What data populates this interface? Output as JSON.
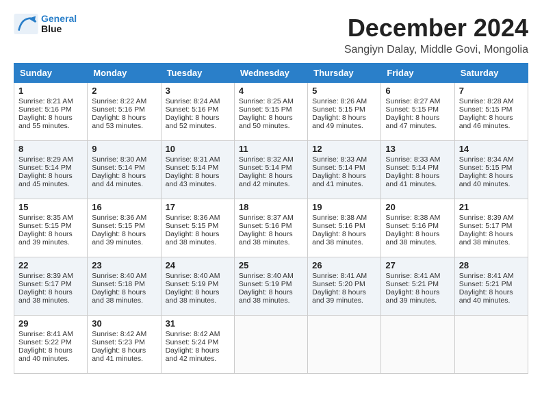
{
  "logo": {
    "line1": "General",
    "line2": "Blue"
  },
  "title": "December 2024",
  "subtitle": "Sangiyn Dalay, Middle Govi, Mongolia",
  "days": [
    "Sunday",
    "Monday",
    "Tuesday",
    "Wednesday",
    "Thursday",
    "Friday",
    "Saturday"
  ],
  "weeks": [
    [
      {
        "num": "1",
        "sunrise": "Sunrise: 8:21 AM",
        "sunset": "Sunset: 5:16 PM",
        "daylight": "Daylight: 8 hours and 55 minutes."
      },
      {
        "num": "2",
        "sunrise": "Sunrise: 8:22 AM",
        "sunset": "Sunset: 5:16 PM",
        "daylight": "Daylight: 8 hours and 53 minutes."
      },
      {
        "num": "3",
        "sunrise": "Sunrise: 8:24 AM",
        "sunset": "Sunset: 5:16 PM",
        "daylight": "Daylight: 8 hours and 52 minutes."
      },
      {
        "num": "4",
        "sunrise": "Sunrise: 8:25 AM",
        "sunset": "Sunset: 5:15 PM",
        "daylight": "Daylight: 8 hours and 50 minutes."
      },
      {
        "num": "5",
        "sunrise": "Sunrise: 8:26 AM",
        "sunset": "Sunset: 5:15 PM",
        "daylight": "Daylight: 8 hours and 49 minutes."
      },
      {
        "num": "6",
        "sunrise": "Sunrise: 8:27 AM",
        "sunset": "Sunset: 5:15 PM",
        "daylight": "Daylight: 8 hours and 47 minutes."
      },
      {
        "num": "7",
        "sunrise": "Sunrise: 8:28 AM",
        "sunset": "Sunset: 5:15 PM",
        "daylight": "Daylight: 8 hours and 46 minutes."
      }
    ],
    [
      {
        "num": "8",
        "sunrise": "Sunrise: 8:29 AM",
        "sunset": "Sunset: 5:14 PM",
        "daylight": "Daylight: 8 hours and 45 minutes."
      },
      {
        "num": "9",
        "sunrise": "Sunrise: 8:30 AM",
        "sunset": "Sunset: 5:14 PM",
        "daylight": "Daylight: 8 hours and 44 minutes."
      },
      {
        "num": "10",
        "sunrise": "Sunrise: 8:31 AM",
        "sunset": "Sunset: 5:14 PM",
        "daylight": "Daylight: 8 hours and 43 minutes."
      },
      {
        "num": "11",
        "sunrise": "Sunrise: 8:32 AM",
        "sunset": "Sunset: 5:14 PM",
        "daylight": "Daylight: 8 hours and 42 minutes."
      },
      {
        "num": "12",
        "sunrise": "Sunrise: 8:33 AM",
        "sunset": "Sunset: 5:14 PM",
        "daylight": "Daylight: 8 hours and 41 minutes."
      },
      {
        "num": "13",
        "sunrise": "Sunrise: 8:33 AM",
        "sunset": "Sunset: 5:14 PM",
        "daylight": "Daylight: 8 hours and 41 minutes."
      },
      {
        "num": "14",
        "sunrise": "Sunrise: 8:34 AM",
        "sunset": "Sunset: 5:15 PM",
        "daylight": "Daylight: 8 hours and 40 minutes."
      }
    ],
    [
      {
        "num": "15",
        "sunrise": "Sunrise: 8:35 AM",
        "sunset": "Sunset: 5:15 PM",
        "daylight": "Daylight: 8 hours and 39 minutes."
      },
      {
        "num": "16",
        "sunrise": "Sunrise: 8:36 AM",
        "sunset": "Sunset: 5:15 PM",
        "daylight": "Daylight: 8 hours and 39 minutes."
      },
      {
        "num": "17",
        "sunrise": "Sunrise: 8:36 AM",
        "sunset": "Sunset: 5:15 PM",
        "daylight": "Daylight: 8 hours and 38 minutes."
      },
      {
        "num": "18",
        "sunrise": "Sunrise: 8:37 AM",
        "sunset": "Sunset: 5:16 PM",
        "daylight": "Daylight: 8 hours and 38 minutes."
      },
      {
        "num": "19",
        "sunrise": "Sunrise: 8:38 AM",
        "sunset": "Sunset: 5:16 PM",
        "daylight": "Daylight: 8 hours and 38 minutes."
      },
      {
        "num": "20",
        "sunrise": "Sunrise: 8:38 AM",
        "sunset": "Sunset: 5:16 PM",
        "daylight": "Daylight: 8 hours and 38 minutes."
      },
      {
        "num": "21",
        "sunrise": "Sunrise: 8:39 AM",
        "sunset": "Sunset: 5:17 PM",
        "daylight": "Daylight: 8 hours and 38 minutes."
      }
    ],
    [
      {
        "num": "22",
        "sunrise": "Sunrise: 8:39 AM",
        "sunset": "Sunset: 5:17 PM",
        "daylight": "Daylight: 8 hours and 38 minutes."
      },
      {
        "num": "23",
        "sunrise": "Sunrise: 8:40 AM",
        "sunset": "Sunset: 5:18 PM",
        "daylight": "Daylight: 8 hours and 38 minutes."
      },
      {
        "num": "24",
        "sunrise": "Sunrise: 8:40 AM",
        "sunset": "Sunset: 5:19 PM",
        "daylight": "Daylight: 8 hours and 38 minutes."
      },
      {
        "num": "25",
        "sunrise": "Sunrise: 8:40 AM",
        "sunset": "Sunset: 5:19 PM",
        "daylight": "Daylight: 8 hours and 38 minutes."
      },
      {
        "num": "26",
        "sunrise": "Sunrise: 8:41 AM",
        "sunset": "Sunset: 5:20 PM",
        "daylight": "Daylight: 8 hours and 39 minutes."
      },
      {
        "num": "27",
        "sunrise": "Sunrise: 8:41 AM",
        "sunset": "Sunset: 5:21 PM",
        "daylight": "Daylight: 8 hours and 39 minutes."
      },
      {
        "num": "28",
        "sunrise": "Sunrise: 8:41 AM",
        "sunset": "Sunset: 5:21 PM",
        "daylight": "Daylight: 8 hours and 40 minutes."
      }
    ],
    [
      {
        "num": "29",
        "sunrise": "Sunrise: 8:41 AM",
        "sunset": "Sunset: 5:22 PM",
        "daylight": "Daylight: 8 hours and 40 minutes."
      },
      {
        "num": "30",
        "sunrise": "Sunrise: 8:42 AM",
        "sunset": "Sunset: 5:23 PM",
        "daylight": "Daylight: 8 hours and 41 minutes."
      },
      {
        "num": "31",
        "sunrise": "Sunrise: 8:42 AM",
        "sunset": "Sunset: 5:24 PM",
        "daylight": "Daylight: 8 hours and 42 minutes."
      },
      null,
      null,
      null,
      null
    ]
  ]
}
